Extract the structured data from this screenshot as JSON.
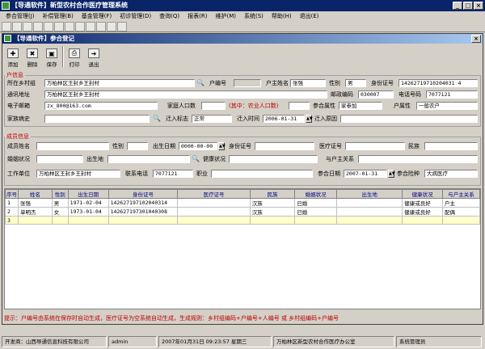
{
  "app_title": "【导通软件】新型农村合作医疗管理系统",
  "menu": [
    "参合管理(J)",
    "补偿管理(B)",
    "基金管理(F)",
    "初诊管理(D)",
    "查询(Q)",
    "报表(R)",
    "维护(M)",
    "系统(S)",
    "帮助(H)",
    "退出(E)"
  ],
  "child_title": "【导通软件】参合登记",
  "toolbar": {
    "add": "添加",
    "delete": "删除",
    "save": "保存",
    "print": "打印",
    "exit": "退出"
  },
  "household": {
    "legend": "户信息",
    "village_label": "所在乡村组",
    "village": "万柏林区王封乡王封村",
    "hh_no_label": "户编号",
    "hh_no": "",
    "head_label": "户主姓名",
    "head": "张强",
    "sex_label": "性别",
    "sex": "男",
    "id_label": "身份证号",
    "id": "14262719710204031 4",
    "addr_label": "通讯地址",
    "addr": "万柏林区王封乡王封村",
    "zip_label": "邮政编码",
    "zip": "030007",
    "tel_label": "电话号码",
    "tel": "7077121",
    "email_label": "电子邮箱",
    "email": "zx_800@163.com",
    "count_label": "家庭人口数",
    "count": "",
    "agri_label": "(其中：农业人口数)",
    "agri": "",
    "type_label": "参合属性",
    "type": "家参加",
    "attr_label": "户属性",
    "attr": "一般农户",
    "history_label": "家族病史",
    "history": "",
    "inflag_label": "迁入标志",
    "inflag": "正常",
    "intime_label": "迁入时间",
    "intime": "2006-01-31",
    "inreason_label": "迁入原因",
    "inreason": ""
  },
  "member": {
    "legend": "成员信息",
    "name_label": "成员姓名",
    "name": "",
    "sex_label": "性别",
    "sex": "",
    "birth_label": "出生日期",
    "birth": "0000-00-00",
    "id_label": "身份证号",
    "id": "",
    "med_label": "医疗证号",
    "med": "",
    "nation_label": "民族",
    "nation": "",
    "marital_label": "婚姻状况",
    "marital": "",
    "birthplace_label": "出生地",
    "birthplace": "",
    "health_label": "健康状况",
    "health": "",
    "relation_label": "与户主关系",
    "relation": "",
    "work_label": "工作单位",
    "work": "万柏林区王封乡王封村",
    "phone_label": "联系电话",
    "phone": "7077121",
    "job_label": "职业",
    "job": "",
    "join_date_label": "参合日期",
    "join_date": "2007-01-31",
    "join_type_label": "参合险种",
    "join_type": "大病医疗"
  },
  "grid": {
    "columns": [
      "序号",
      "姓名",
      "性别",
      "出生日期",
      "身份证号",
      "医疗证号",
      "民族",
      "婚姻状况",
      "出生地",
      "健康状况",
      "与户主关系"
    ],
    "rows": [
      [
        "1",
        "张强",
        "男",
        "1971-02-04",
        "142627197102040314",
        "",
        "汉族",
        "已婚",
        "",
        "健康或良好",
        "户主"
      ],
      [
        "2",
        "单明杰",
        "女",
        "1973-01-04",
        "142627197301040308",
        "",
        "汉族",
        "已婚",
        "",
        "健康或良好",
        "配偶"
      ],
      [
        "3",
        "",
        "",
        "",
        "",
        "",
        "",
        "",
        "",
        "",
        ""
      ]
    ]
  },
  "hint": "提示：户编号由系统在保存时自动生成，医疗证号为空系统自动生成，生成规则：乡村组编码+户编号+人编号  或  乡村组编码+户编号",
  "status": {
    "dev": "开发商：山西导通信息科技有限公司",
    "user": "admin",
    "datetime": "2007年01月31日 09:23:57 星期三",
    "org": "万柏林区新型农村合作医疗办公室",
    "role": "系统管理员"
  }
}
